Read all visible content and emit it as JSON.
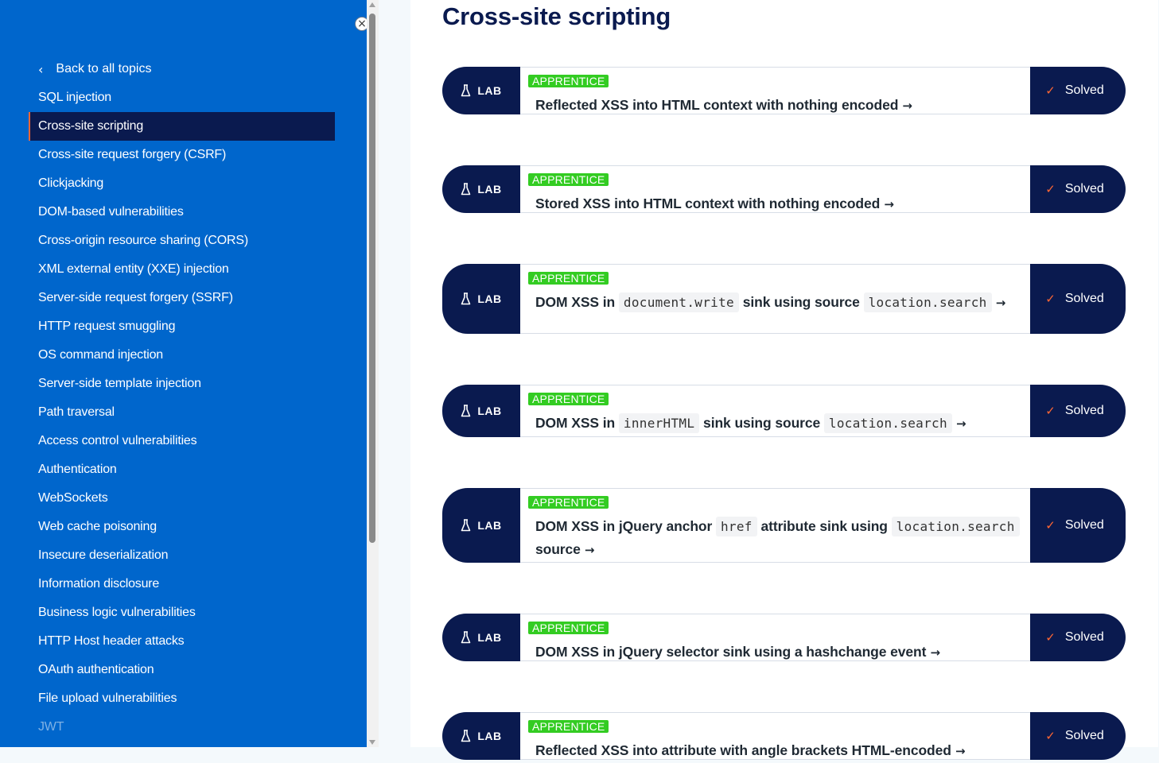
{
  "sidebar": {
    "close_icon": "×",
    "back_label": "Back to all topics",
    "items": [
      {
        "label": "SQL injection",
        "active": false
      },
      {
        "label": "Cross-site scripting",
        "active": true
      },
      {
        "label": "Cross-site request forgery (CSRF)",
        "active": false
      },
      {
        "label": "Clickjacking",
        "active": false
      },
      {
        "label": "DOM-based vulnerabilities",
        "active": false
      },
      {
        "label": "Cross-origin resource sharing (CORS)",
        "active": false
      },
      {
        "label": "XML external entity (XXE) injection",
        "active": false
      },
      {
        "label": "Server-side request forgery (SSRF)",
        "active": false
      },
      {
        "label": "HTTP request smuggling",
        "active": false
      },
      {
        "label": "OS command injection",
        "active": false
      },
      {
        "label": "Server-side template injection",
        "active": false
      },
      {
        "label": "Path traversal",
        "active": false
      },
      {
        "label": "Access control vulnerabilities",
        "active": false
      },
      {
        "label": "Authentication",
        "active": false
      },
      {
        "label": "WebSockets",
        "active": false
      },
      {
        "label": "Web cache poisoning",
        "active": false
      },
      {
        "label": "Insecure deserialization",
        "active": false
      },
      {
        "label": "Information disclosure",
        "active": false
      },
      {
        "label": "Business logic vulnerabilities",
        "active": false
      },
      {
        "label": "HTTP Host header attacks",
        "active": false
      },
      {
        "label": "OAuth authentication",
        "active": false
      },
      {
        "label": "File upload vulnerabilities",
        "active": false
      },
      {
        "label": "JWT",
        "active": false,
        "faded": true
      }
    ]
  },
  "main": {
    "title": "Cross-site scripting",
    "lab_label": "LAB",
    "solved_label": "Solved",
    "labs": [
      {
        "level": "APPRENTICE",
        "parts": [
          {
            "t": "Reflected XSS into HTML context with nothing encoded"
          }
        ]
      },
      {
        "level": "APPRENTICE",
        "parts": [
          {
            "t": "Stored XSS into HTML context with nothing encoded"
          }
        ]
      },
      {
        "level": "APPRENTICE",
        "parts": [
          {
            "t": "DOM XSS in "
          },
          {
            "c": "document.write"
          },
          {
            "t": " sink using source "
          },
          {
            "c": "location.search"
          }
        ]
      },
      {
        "level": "APPRENTICE",
        "parts": [
          {
            "t": "DOM XSS in "
          },
          {
            "c": "innerHTML"
          },
          {
            "t": " sink using source "
          },
          {
            "c": "location.search"
          }
        ]
      },
      {
        "level": "APPRENTICE",
        "parts": [
          {
            "t": "DOM XSS in jQuery anchor "
          },
          {
            "c": "href"
          },
          {
            "t": " attribute sink using "
          },
          {
            "c": "location.search"
          },
          {
            "t": " source"
          }
        ]
      },
      {
        "level": "APPRENTICE",
        "parts": [
          {
            "t": "DOM XSS in jQuery selector sink using a hashchange event"
          }
        ]
      },
      {
        "level": "APPRENTICE",
        "parts": [
          {
            "t": "Reflected XSS into attribute with angle brackets HTML-encoded"
          }
        ]
      }
    ]
  }
}
